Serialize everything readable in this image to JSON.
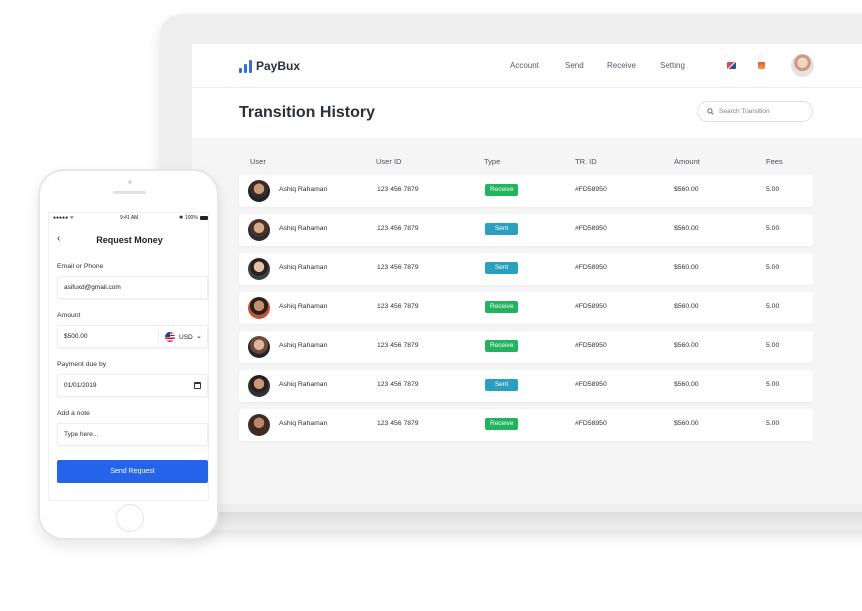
{
  "app": {
    "name": "PayBux",
    "nav": [
      "Account",
      "Send",
      "Receive",
      "Setting"
    ],
    "page_title": "Transition History",
    "search_placeholder": "Search Transition"
  },
  "table": {
    "columns": [
      "User",
      "User ID",
      "Type",
      "TR. ID",
      "Amount",
      "Fees"
    ],
    "rows": [
      {
        "user": "Ashiq Rahaman",
        "user_id": "123 456 7879",
        "type": "Receive",
        "tr_id": "#FD58950",
        "amount": "$560.00",
        "fees": "5.00"
      },
      {
        "user": "Ashiq Rahaman",
        "user_id": "123 456 7879",
        "type": "Sent",
        "tr_id": "#FD58950",
        "amount": "$560.00",
        "fees": "5.00"
      },
      {
        "user": "Ashiq Rahaman",
        "user_id": "123 456 7879",
        "type": "Sent",
        "tr_id": "#FD58950",
        "amount": "$560.00",
        "fees": "5.00"
      },
      {
        "user": "Ashiq Rahaman",
        "user_id": "123 456 7879",
        "type": "Receive",
        "tr_id": "#FD58950",
        "amount": "$560.00",
        "fees": "5.00"
      },
      {
        "user": "Ashiq Rahaman",
        "user_id": "123 456 7879",
        "type": "Receive",
        "tr_id": "#FD58950",
        "amount": "$560.00",
        "fees": "5.00"
      },
      {
        "user": "Ashiq Rahaman",
        "user_id": "123 456 7879",
        "type": "Sent",
        "tr_id": "#FD58950",
        "amount": "$560.00",
        "fees": "5.00"
      },
      {
        "user": "Ashiq Rahaman",
        "user_id": "123 456 7879",
        "type": "Receive",
        "tr_id": "#FD58950",
        "amount": "$560.00",
        "fees": "5.00"
      }
    ]
  },
  "phone": {
    "status_time": "9:41 AM",
    "status_battery": "100%",
    "title": "Request Money",
    "email_label": "Email or Phone",
    "email_value": "asifuxd@gmail.com",
    "amount_label": "Amount",
    "amount_value": "$500.00",
    "currency": "USD",
    "due_label": "Payment due by",
    "due_value": "01/01/2019",
    "note_label": "Add a note",
    "note_placeholder": "Type here...",
    "button": "Send Request"
  },
  "colors": {
    "brand": "#2f6fe6",
    "receive": "#22b35e",
    "sent": "#2a9fc0",
    "primary_button": "#2563eb"
  }
}
